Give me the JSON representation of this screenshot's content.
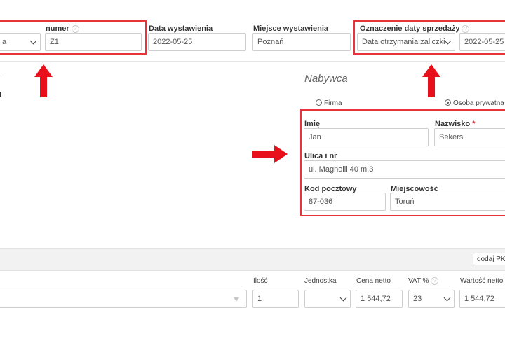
{
  "header": {
    "series_value": "a",
    "numer_label": "numer",
    "numer_value": "Z1",
    "issue_date_label": "Data wystawienia",
    "issue_date_value": "2022-05-25",
    "issue_place_label": "Miejsce wystawienia",
    "issue_place_value": "Poznań",
    "sale_date_type_label": "Oznaczenie daty sprzedaży",
    "sale_date_type_value": "Data otrzymania zaliczki",
    "sale_date_value": "2022-05-25"
  },
  "buyer": {
    "title": "Nabywca",
    "radio_company": "Firma",
    "radio_private": "Osoba prywatna",
    "first_name_label": "Imię",
    "first_name_value": "Jan",
    "last_name_label": "Nazwisko",
    "required_mark": "*",
    "last_name_value": "Bekers",
    "street_label": "Ulica i nr",
    "street_value": "ul. Magnolii 40 m.3",
    "postcode_label": "Kod pocztowy",
    "postcode_value": "87-036",
    "city_label": "Miejscowość",
    "city_value": "Toruń"
  },
  "items": {
    "add_pkwiu_button": "dodaj PKW",
    "col_qty": "Ilość",
    "col_unit": "Jednostka",
    "col_net_price": "Cena netto",
    "col_vat": "VAT %",
    "col_net_value": "Wartość netto",
    "qty_value": "1",
    "net_price_value": "1 544,72",
    "vat_value": "23",
    "net_value_value": "1 544,72"
  },
  "colors": {
    "highlight": "#e8323c",
    "arrow": "#e8101a"
  }
}
